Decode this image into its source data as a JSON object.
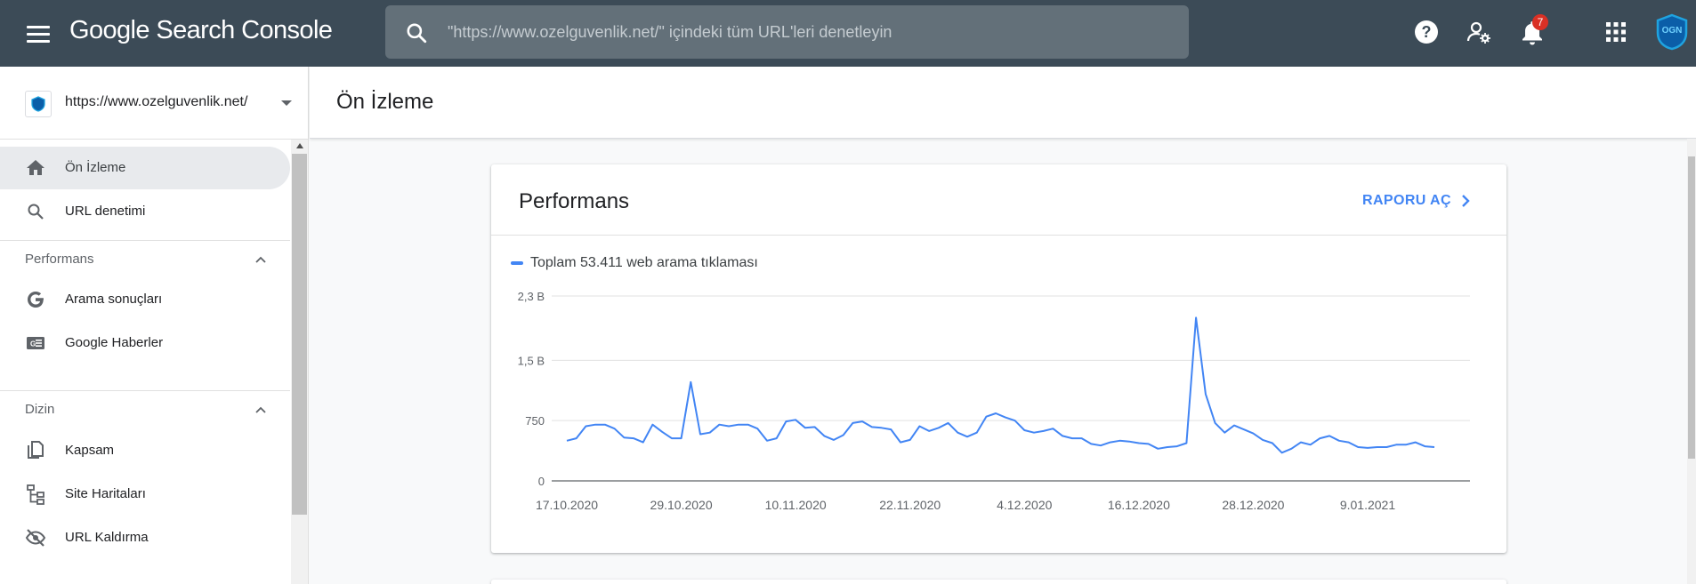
{
  "header": {
    "brand": "Google Search Console",
    "search_placeholder": "\"https://www.ozelguvenlik.net/\" içindeki tüm URL'leri denetleyin",
    "notification_count": "7",
    "avatar_text": "OGN"
  },
  "sidebar": {
    "property_url": "https://www.ozelguvenlik.net/",
    "items": [
      {
        "label": "Ön İzleme",
        "icon": "home-icon"
      },
      {
        "label": "URL denetimi",
        "icon": "search-icon"
      }
    ],
    "sections": [
      {
        "label": "Performans",
        "items": [
          {
            "label": "Arama sonuçları",
            "icon": "google-g-icon"
          },
          {
            "label": "Google Haberler",
            "icon": "google-news-icon"
          }
        ]
      },
      {
        "label": "Dizin",
        "items": [
          {
            "label": "Kapsam",
            "icon": "copy-icon"
          },
          {
            "label": "Site Haritaları",
            "icon": "sitemap-icon"
          },
          {
            "label": "URL Kaldırma",
            "icon": "visibility-off-icon"
          }
        ]
      }
    ]
  },
  "page": {
    "title": "Ön İzleme"
  },
  "performance_card": {
    "title": "Performans",
    "report_link": "RAPORU AÇ",
    "legend": "Toplam 53.411 web arama tıklaması"
  },
  "colors": {
    "topbar": "#3c4b57",
    "accent": "#4285f4",
    "badge": "#d93025"
  },
  "chart_data": {
    "type": "line",
    "grid": true,
    "ylim": [
      0,
      2300
    ],
    "yticks": [
      0,
      750,
      1500,
      2300
    ],
    "ytick_labels": [
      "0",
      "750",
      "1,5 B",
      "2,3 B"
    ],
    "xtick_labels": [
      "17.10.2020",
      "29.10.2020",
      "10.11.2020",
      "22.11.2020",
      "4.12.2020",
      "16.12.2020",
      "28.12.2020",
      "9.01.2021"
    ],
    "xtick_indices": [
      0,
      12,
      24,
      36,
      48,
      60,
      72,
      84
    ],
    "series": [
      {
        "name": "Toplam 53.411 web arama tıklaması",
        "color": "#4285f4",
        "values": [
          500,
          530,
          680,
          700,
          700,
          650,
          540,
          530,
          480,
          700,
          610,
          530,
          530,
          1230,
          580,
          600,
          700,
          680,
          700,
          700,
          650,
          500,
          530,
          740,
          760,
          660,
          670,
          560,
          510,
          570,
          720,
          740,
          670,
          660,
          640,
          480,
          510,
          680,
          620,
          660,
          720,
          600,
          550,
          600,
          800,
          840,
          790,
          750,
          630,
          600,
          620,
          650,
          560,
          530,
          530,
          460,
          440,
          480,
          500,
          490,
          470,
          460,
          400,
          420,
          430,
          470,
          2030,
          1080,
          720,
          600,
          690,
          640,
          590,
          510,
          470,
          350,
          400,
          480,
          450,
          530,
          560,
          500,
          480,
          420,
          410,
          420,
          420,
          450,
          450,
          480,
          430,
          420
        ]
      }
    ]
  }
}
